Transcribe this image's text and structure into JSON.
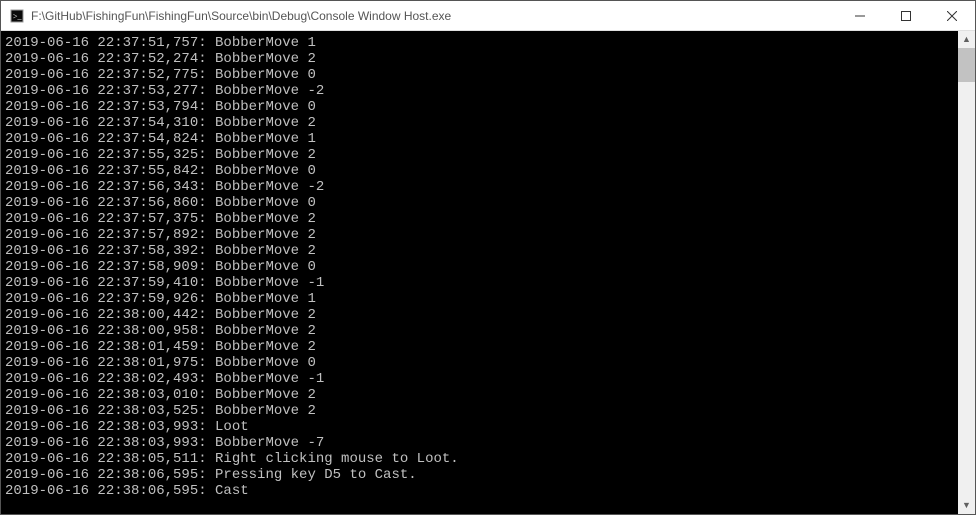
{
  "window": {
    "title": "F:\\GitHub\\FishingFun\\FishingFun\\Source\\bin\\Debug\\Console Window Host.exe"
  },
  "log_lines": [
    {
      "ts": "2019-06-16 22:37:51,757:",
      "msg": "BobberMove 1"
    },
    {
      "ts": "2019-06-16 22:37:52,274:",
      "msg": "BobberMove 2"
    },
    {
      "ts": "2019-06-16 22:37:52,775:",
      "msg": "BobberMove 0"
    },
    {
      "ts": "2019-06-16 22:37:53,277:",
      "msg": "BobberMove -2"
    },
    {
      "ts": "2019-06-16 22:37:53,794:",
      "msg": "BobberMove 0"
    },
    {
      "ts": "2019-06-16 22:37:54,310:",
      "msg": "BobberMove 2"
    },
    {
      "ts": "2019-06-16 22:37:54,824:",
      "msg": "BobberMove 1"
    },
    {
      "ts": "2019-06-16 22:37:55,325:",
      "msg": "BobberMove 2"
    },
    {
      "ts": "2019-06-16 22:37:55,842:",
      "msg": "BobberMove 0"
    },
    {
      "ts": "2019-06-16 22:37:56,343:",
      "msg": "BobberMove -2"
    },
    {
      "ts": "2019-06-16 22:37:56,860:",
      "msg": "BobberMove 0"
    },
    {
      "ts": "2019-06-16 22:37:57,375:",
      "msg": "BobberMove 2"
    },
    {
      "ts": "2019-06-16 22:37:57,892:",
      "msg": "BobberMove 2"
    },
    {
      "ts": "2019-06-16 22:37:58,392:",
      "msg": "BobberMove 2"
    },
    {
      "ts": "2019-06-16 22:37:58,909:",
      "msg": "BobberMove 0"
    },
    {
      "ts": "2019-06-16 22:37:59,410:",
      "msg": "BobberMove -1"
    },
    {
      "ts": "2019-06-16 22:37:59,926:",
      "msg": "BobberMove 1"
    },
    {
      "ts": "2019-06-16 22:38:00,442:",
      "msg": "BobberMove 2"
    },
    {
      "ts": "2019-06-16 22:38:00,958:",
      "msg": "BobberMove 2"
    },
    {
      "ts": "2019-06-16 22:38:01,459:",
      "msg": "BobberMove 2"
    },
    {
      "ts": "2019-06-16 22:38:01,975:",
      "msg": "BobberMove 0"
    },
    {
      "ts": "2019-06-16 22:38:02,493:",
      "msg": "BobberMove -1"
    },
    {
      "ts": "2019-06-16 22:38:03,010:",
      "msg": "BobberMove 2"
    },
    {
      "ts": "2019-06-16 22:38:03,525:",
      "msg": "BobberMove 2"
    },
    {
      "ts": "2019-06-16 22:38:03,993:",
      "msg": "Loot"
    },
    {
      "ts": "2019-06-16 22:38:03,993:",
      "msg": "BobberMove -7"
    },
    {
      "ts": "2019-06-16 22:38:05,511:",
      "msg": "Right clicking mouse to Loot."
    },
    {
      "ts": "2019-06-16 22:38:06,595:",
      "msg": "Pressing key D5 to Cast."
    },
    {
      "ts": "2019-06-16 22:38:06,595:",
      "msg": "Cast"
    }
  ]
}
